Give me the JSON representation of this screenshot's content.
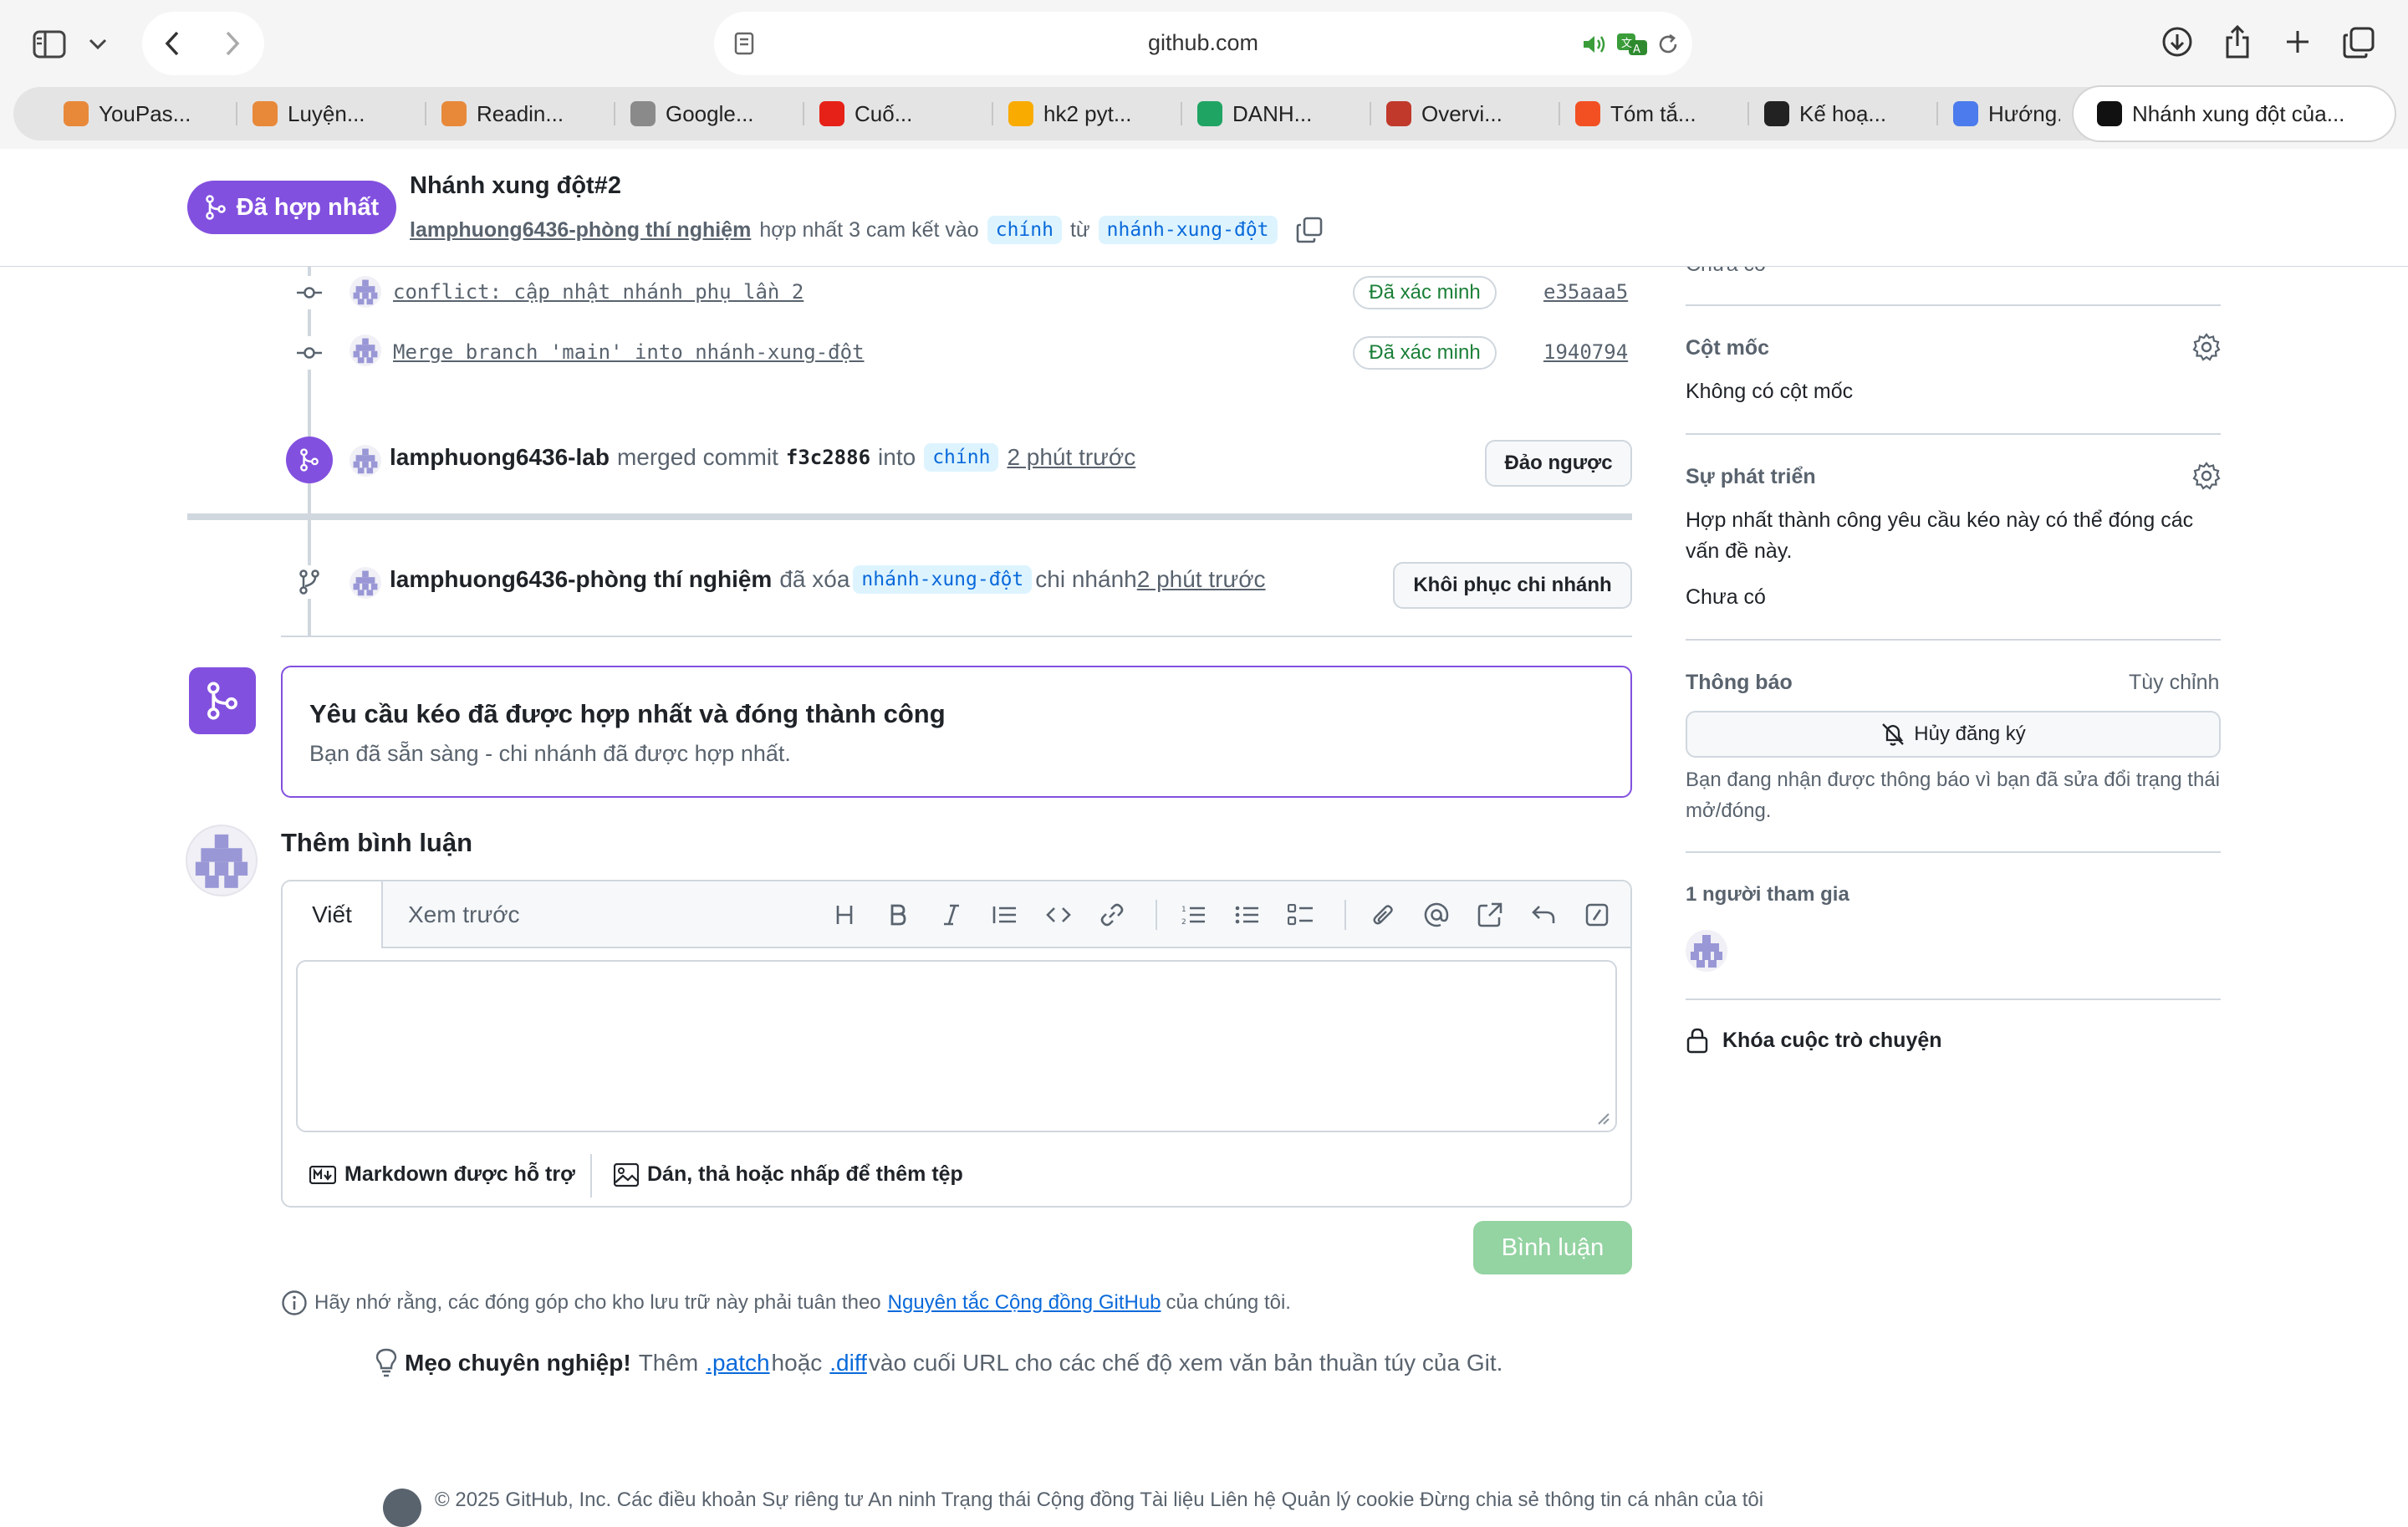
{
  "browser": {
    "url": "github.com",
    "tabs": [
      {
        "label": "YouPas...",
        "icon": "youpass-icon",
        "color": "#e8893a"
      },
      {
        "label": "Luyện...",
        "icon": "luyen-icon",
        "color": "#e8893a"
      },
      {
        "label": "Readin...",
        "icon": "reading-icon",
        "color": "#e8893a"
      },
      {
        "label": "Google...",
        "icon": "google-docs-icon",
        "color": "#8a8a8a"
      },
      {
        "label": "Cuố...",
        "icon": "youtube-icon",
        "color": "#e62117"
      },
      {
        "label": "hk2 pyt...",
        "icon": "colab-icon",
        "color": "#f9ab00"
      },
      {
        "label": "DANH...",
        "icon": "sheets-icon",
        "color": "#1fa463"
      },
      {
        "label": "Overvi...",
        "icon": "overview-icon",
        "color": "#c0392b"
      },
      {
        "label": "Tóm tắ...",
        "icon": "microsoft-icon",
        "color": "#f25022"
      },
      {
        "label": "Kế hoạ...",
        "icon": "chatgpt-icon",
        "color": "#222222"
      },
      {
        "label": "Hướng...",
        "icon": "gemini-icon",
        "color": "#4b7bec"
      },
      {
        "label": "Nhánh xung đột của...",
        "icon": "github-icon",
        "color": "#111111"
      }
    ]
  },
  "pr": {
    "status": "Đã hợp nhất",
    "title": "Nhánh xung đột#2",
    "author": "lamphuong6436-phòng thí nghiệm",
    "merge_text": "hợp nhất 3 cam kết vào",
    "base_branch": "chính",
    "from_text": "từ",
    "head_branch": "nhánh-xung-đột"
  },
  "timeline": {
    "commits": [
      {
        "message": "conflict: cập nhật nhánh phụ lần 2",
        "badge": "Đã xác minh",
        "sha": "e35aaa5"
      },
      {
        "message": "Merge branch 'main' into nhánh-xung-đột",
        "badge": "Đã xác minh",
        "sha": "1940794"
      }
    ],
    "merge_event": {
      "user": "lamphuong6436-lab",
      "action": "merged commit",
      "commit": "f3c2886",
      "into": "into",
      "branch": "chính",
      "time": "2 phút trước",
      "button": "Đảo ngược"
    },
    "delete_event": {
      "user": "lamphuong6436-phòng thí nghiệm",
      "action": "đã xóa",
      "branch": "nhánh-xung-đột",
      "suffix": "chi nhánh",
      "time": "2 phút trước",
      "button": "Khôi phục chi nhánh"
    },
    "merged_box": {
      "title": "Yêu cầu kéo đã được hợp nhất và đóng thành công",
      "subtitle": "Bạn đã sẵn sàng - chi nhánh đã được hợp nhất."
    }
  },
  "comment": {
    "heading": "Thêm bình luận",
    "tab_write": "Viết",
    "tab_preview": "Xem trước",
    "markdown_note": "Markdown được hỗ trợ",
    "attach_note": "Dán, thả hoặc nhấp để thêm tệp",
    "submit": "Bình luận"
  },
  "guidelines": {
    "prefix": "Hãy nhớ rằng, các đóng góp cho kho lưu trữ này phải tuân theo",
    "link": "Nguyên tắc Cộng đồng GitHub",
    "suffix": "của chúng tôi."
  },
  "protip": {
    "bold": "Mẹo chuyên nghiệp!",
    "t1": "Thêm",
    "patch": ".patch",
    "t2": "hoặc",
    "diff": ".diff",
    "t3": "vào cuối URL cho các chế độ xem văn bản thuần túy của Git."
  },
  "footer": {
    "text": "© 2025 GitHub, Inc.   Các điều khoản   Sự riêng tư   An ninh   Trạng thái   Cộng đồng   Tài liệu   Liên hệ   Quản lý cookie   Đừng chia sẻ thông tin cá nhân của tôi"
  },
  "sidebar": {
    "prev_value": "Chưa có",
    "milestone_label": "Cột mốc",
    "milestone_value": "Không có cột mốc",
    "development_label": "Sự phát triển",
    "development_text": "Hợp nhất thành công yêu cầu kéo này có thể đóng các vấn đề này.",
    "development_value": "Chưa có",
    "notifications_label": "Thông báo",
    "customize": "Tùy chỉnh",
    "unsubscribe": "Hủy đăng ký",
    "notification_reason": "Bạn đang nhận được thông báo vì bạn đã sửa đổi trạng thái mở/đóng.",
    "participants_label": "1 người tham gia",
    "lock": "Khóa cuộc trò chuyện"
  }
}
